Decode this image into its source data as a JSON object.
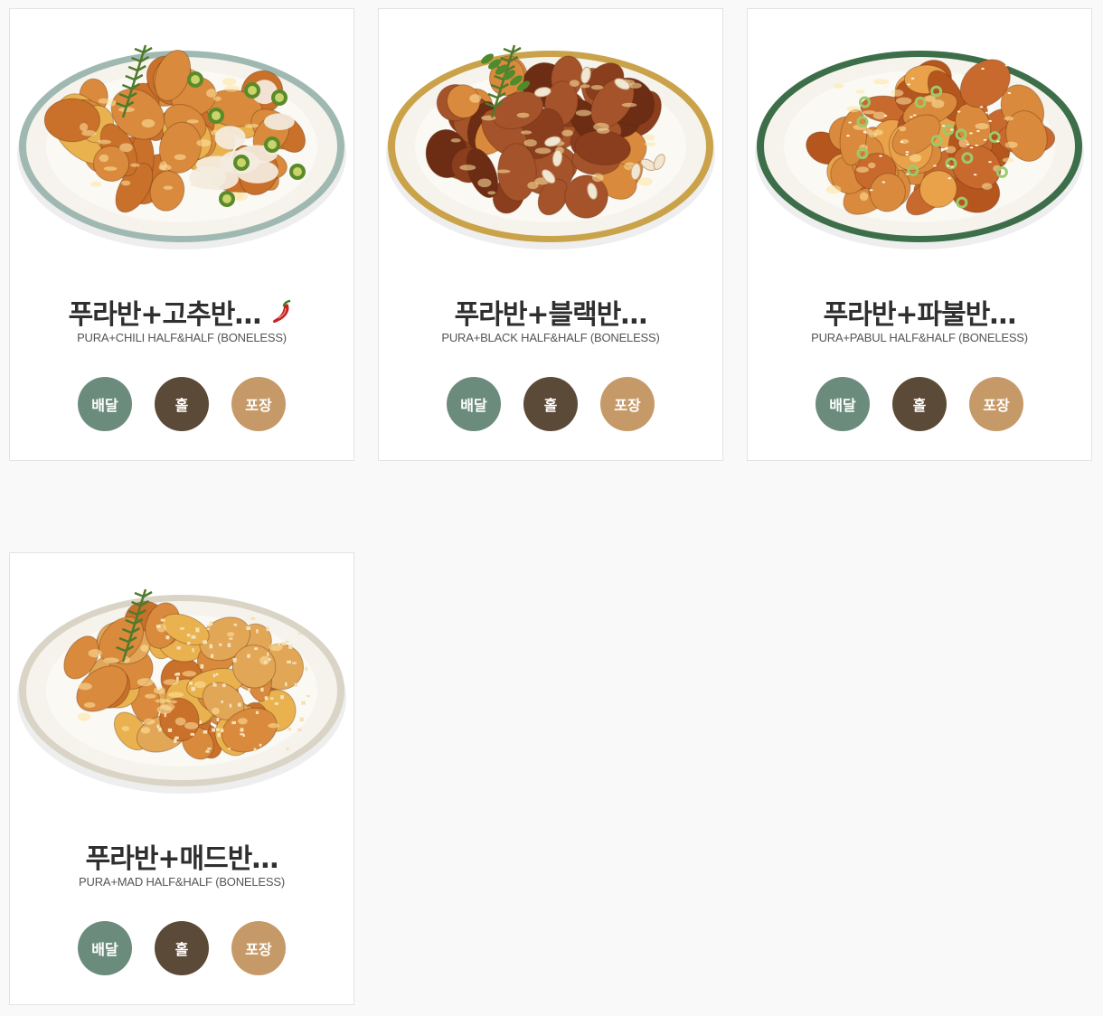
{
  "menu_items": [
    {
      "name": "푸라반+고추반…",
      "english": "PURA+CHILI HALF&HALF (BONELESS)",
      "spicy": true,
      "plate_rim": "#9fb9b2",
      "buttons": {
        "delivery": "배달",
        "hall": "홀",
        "takeout": "포장"
      }
    },
    {
      "name": "푸라반+블랙반…",
      "english": "PURA+BLACK HALF&HALF (BONELESS)",
      "spicy": false,
      "plate_rim": "#c9a24a",
      "buttons": {
        "delivery": "배달",
        "hall": "홀",
        "takeout": "포장"
      }
    },
    {
      "name": "푸라반+파불반…",
      "english": "PURA+PABUL HALF&HALF (BONELESS)",
      "spicy": false,
      "plate_rim": "#3d6e4a",
      "buttons": {
        "delivery": "배달",
        "hall": "홀",
        "takeout": "포장"
      }
    },
    {
      "name": "푸라반+매드반…",
      "english": "PURA+MAD HALF&HALF (BONELESS)",
      "spicy": false,
      "plate_rim": "#d9d4c6",
      "buttons": {
        "delivery": "배달",
        "hall": "홀",
        "takeout": "포장"
      }
    }
  ],
  "colors": {
    "delivery": "#6b8c7d",
    "hall": "#5c4a38",
    "takeout": "#c69a68",
    "title": "#2f2f2f"
  },
  "icons": {
    "spicy": "chili-pepper-icon"
  }
}
